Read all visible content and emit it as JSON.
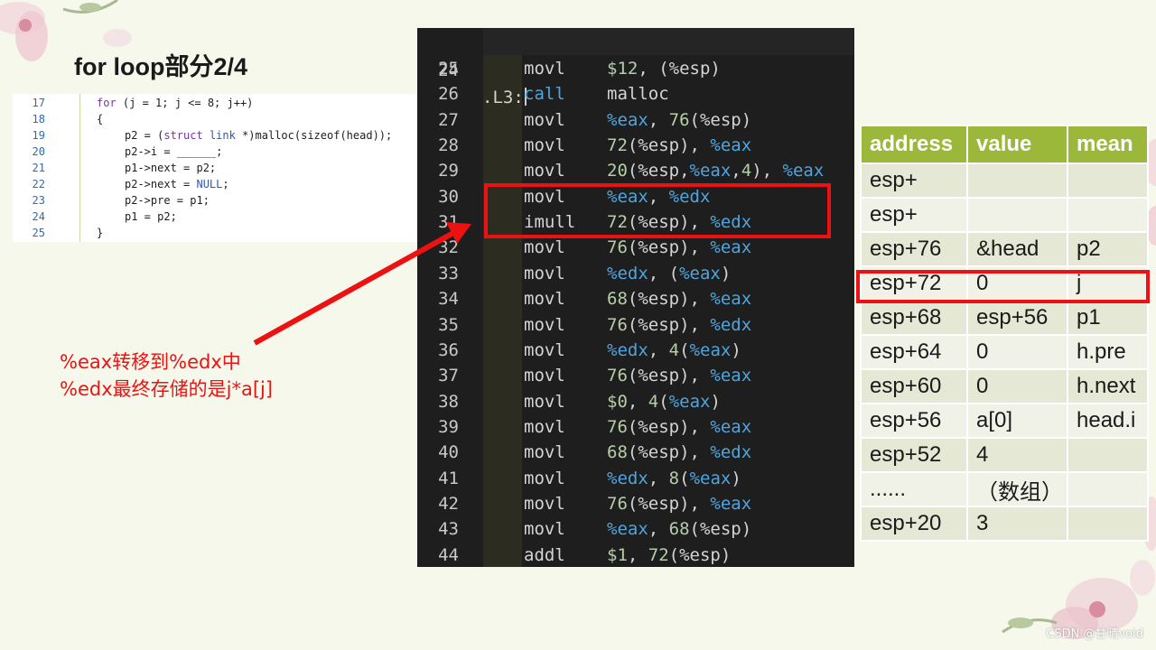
{
  "slide_title": "for loop部分2/4",
  "c_code": [
    {
      "num": "17",
      "indent": 0,
      "parts": [
        {
          "t": "for",
          "c": "kw"
        },
        {
          "t": " (j = 1; j <= 8; j++)",
          "c": ""
        }
      ]
    },
    {
      "num": "18",
      "indent": 0,
      "parts": [
        {
          "t": "{",
          "c": ""
        }
      ]
    },
    {
      "num": "19",
      "indent": 1,
      "parts": [
        {
          "t": "p2 = (",
          "c": ""
        },
        {
          "t": "struct",
          "c": "kw"
        },
        {
          "t": " ",
          "c": ""
        },
        {
          "t": "link",
          "c": "ty"
        },
        {
          "t": " *)malloc(sizeof(head));",
          "c": ""
        }
      ]
    },
    {
      "num": "20",
      "indent": 1,
      "parts": [
        {
          "t": "p2->i = ______;",
          "c": ""
        }
      ]
    },
    {
      "num": "21",
      "indent": 1,
      "parts": [
        {
          "t": "p1->next = p2;",
          "c": ""
        }
      ]
    },
    {
      "num": "22",
      "indent": 1,
      "parts": [
        {
          "t": "p2->next = ",
          "c": ""
        },
        {
          "t": "NULL",
          "c": "ty"
        },
        {
          "t": ";",
          "c": ""
        }
      ]
    },
    {
      "num": "23",
      "indent": 1,
      "parts": [
        {
          "t": "p2->pre = p1;",
          "c": ""
        }
      ]
    },
    {
      "num": "24",
      "indent": 1,
      "parts": [
        {
          "t": "p1 = p2;",
          "c": ""
        }
      ]
    },
    {
      "num": "25",
      "indent": 0,
      "parts": [
        {
          "t": "}",
          "c": ""
        }
      ]
    }
  ],
  "asm": {
    "label_line": {
      "num": "24",
      "label": ".L3:"
    },
    "lines": [
      {
        "num": "25",
        "op": "movl",
        "arg": [
          [
            "$12",
            "num"
          ],
          [
            ", (%esp)",
            ""
          ]
        ]
      },
      {
        "num": "26",
        "op": "call",
        "opc": "op-call",
        "arg": [
          [
            "malloc",
            ""
          ]
        ]
      },
      {
        "num": "27",
        "op": "movl",
        "arg": [
          [
            "%eax",
            "reg"
          ],
          [
            ", ",
            ""
          ],
          [
            "76",
            "num"
          ],
          [
            "(%esp)",
            ""
          ]
        ]
      },
      {
        "num": "28",
        "op": "movl",
        "arg": [
          [
            "72",
            "num"
          ],
          [
            "(%esp), ",
            ""
          ],
          [
            "%eax",
            "reg"
          ]
        ]
      },
      {
        "num": "29",
        "op": "movl",
        "arg": [
          [
            "20",
            "num"
          ],
          [
            "(%esp,",
            ""
          ],
          [
            "%eax",
            "reg"
          ],
          [
            ",",
            ""
          ],
          [
            "4",
            "num"
          ],
          [
            "), ",
            ""
          ],
          [
            "%eax",
            "reg"
          ]
        ]
      },
      {
        "num": "30",
        "op": "movl",
        "arg": [
          [
            "%eax",
            "reg"
          ],
          [
            ", ",
            ""
          ],
          [
            "%edx",
            "reg"
          ]
        ]
      },
      {
        "num": "31",
        "op": "imull",
        "arg": [
          [
            "72",
            "num"
          ],
          [
            "(%esp), ",
            ""
          ],
          [
            "%edx",
            "reg"
          ]
        ]
      },
      {
        "num": "32",
        "op": "movl",
        "arg": [
          [
            "76",
            "num"
          ],
          [
            "(%esp), ",
            ""
          ],
          [
            "%eax",
            "reg"
          ]
        ]
      },
      {
        "num": "33",
        "op": "movl",
        "arg": [
          [
            "%edx",
            "reg"
          ],
          [
            ", (",
            ""
          ],
          [
            "%eax",
            "reg"
          ],
          [
            ")",
            ""
          ]
        ]
      },
      {
        "num": "34",
        "op": "movl",
        "arg": [
          [
            "68",
            "num"
          ],
          [
            "(%esp), ",
            ""
          ],
          [
            "%eax",
            "reg"
          ]
        ]
      },
      {
        "num": "35",
        "op": "movl",
        "arg": [
          [
            "76",
            "num"
          ],
          [
            "(%esp), ",
            ""
          ],
          [
            "%edx",
            "reg"
          ]
        ]
      },
      {
        "num": "36",
        "op": "movl",
        "arg": [
          [
            "%edx",
            "reg"
          ],
          [
            ", ",
            ""
          ],
          [
            "4",
            "num"
          ],
          [
            "(",
            ""
          ],
          [
            "%eax",
            "reg"
          ],
          [
            ")",
            ""
          ]
        ]
      },
      {
        "num": "37",
        "op": "movl",
        "arg": [
          [
            "76",
            "num"
          ],
          [
            "(%esp), ",
            ""
          ],
          [
            "%eax",
            "reg"
          ]
        ]
      },
      {
        "num": "38",
        "op": "movl",
        "arg": [
          [
            "$0",
            "num"
          ],
          [
            ", ",
            ""
          ],
          [
            "4",
            "num"
          ],
          [
            "(",
            ""
          ],
          [
            "%eax",
            "reg"
          ],
          [
            ")",
            ""
          ]
        ]
      },
      {
        "num": "39",
        "op": "movl",
        "arg": [
          [
            "76",
            "num"
          ],
          [
            "(%esp), ",
            ""
          ],
          [
            "%eax",
            "reg"
          ]
        ]
      },
      {
        "num": "40",
        "op": "movl",
        "arg": [
          [
            "68",
            "num"
          ],
          [
            "(%esp), ",
            ""
          ],
          [
            "%edx",
            "reg"
          ]
        ]
      },
      {
        "num": "41",
        "op": "movl",
        "arg": [
          [
            "%edx",
            "reg"
          ],
          [
            ", ",
            ""
          ],
          [
            "8",
            "num"
          ],
          [
            "(",
            ""
          ],
          [
            "%eax",
            "reg"
          ],
          [
            ")",
            ""
          ]
        ]
      },
      {
        "num": "42",
        "op": "movl",
        "arg": [
          [
            "76",
            "num"
          ],
          [
            "(%esp), ",
            ""
          ],
          [
            "%eax",
            "reg"
          ]
        ]
      },
      {
        "num": "43",
        "op": "movl",
        "arg": [
          [
            "%eax",
            "reg"
          ],
          [
            ", ",
            ""
          ],
          [
            "68",
            "num"
          ],
          [
            "(%esp)",
            ""
          ]
        ]
      },
      {
        "num": "44",
        "op": "addl",
        "arg": [
          [
            "$1",
            "num"
          ],
          [
            ", ",
            ""
          ],
          [
            "72",
            "num"
          ],
          [
            "(%esp)",
            ""
          ]
        ]
      }
    ]
  },
  "annotation": {
    "line1": "%eax转移到%edx中",
    "line2": "%edx最终存储的是j*a[j]"
  },
  "stack_table": {
    "headers": [
      "address",
      "value",
      "mean"
    ],
    "rows": [
      [
        "esp+",
        "",
        ""
      ],
      [
        "esp+",
        "",
        ""
      ],
      [
        "esp+76",
        "&head",
        "p2"
      ],
      [
        "esp+72",
        "0",
        "j"
      ],
      [
        "esp+68",
        "esp+56",
        "p1"
      ],
      [
        "esp+64",
        "0",
        "h.pre"
      ],
      [
        "esp+60",
        "0",
        "h.next"
      ],
      [
        "esp+56",
        "a[0]",
        "head.i"
      ],
      [
        "esp+52",
        "4",
        ""
      ],
      [
        "......",
        "（数组）",
        ""
      ],
      [
        "esp+20",
        "3",
        ""
      ]
    ]
  },
  "watermark": "CSDN @甘晴void",
  "colors": {
    "highlight": "#ee1111",
    "table_header": "#9cb83a",
    "editor_bg": "#1e1e1e"
  }
}
